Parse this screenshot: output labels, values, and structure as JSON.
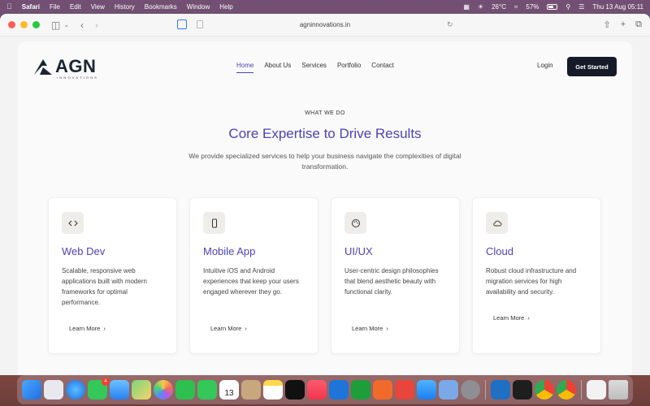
{
  "menubar": {
    "app": "Safari",
    "items": [
      "File",
      "Edit",
      "View",
      "History",
      "Bookmarks",
      "Window",
      "Help"
    ],
    "weather": "26°C",
    "battery": "57%",
    "datetime": "Thu 13 Aug  05:11"
  },
  "browser": {
    "url": "agninnovations.in"
  },
  "site": {
    "logo_text": "AGN",
    "logo_sub": "INNOVATIONS",
    "nav": [
      "Home",
      "About Us",
      "Services",
      "Portfolio",
      "Contact"
    ],
    "active_nav": "Home",
    "login": "Login",
    "cta": "Get Started"
  },
  "section": {
    "kicker": "WHAT WE DO",
    "title": "Core Expertise to Drive Results",
    "lead": "We provide specialized services to help your business navigate the complexities of digital transformation."
  },
  "cards": [
    {
      "icon": "code-icon",
      "title": "Web Dev",
      "desc": "Scalable, responsive web applications built with modern frameworks for optimal performance.",
      "link": "Learn More"
    },
    {
      "icon": "mobile-icon",
      "title": "Mobile App",
      "desc": "Intuitive iOS and Android experiences that keep your users engaged wherever they go.",
      "link": "Learn More"
    },
    {
      "icon": "palette-icon",
      "title": "UI/UX",
      "desc": "User-centric design philosophies that blend aesthetic beauty with functional clarity.",
      "link": "Learn More"
    },
    {
      "icon": "cloud-icon",
      "title": "Cloud",
      "desc": "Robust cloud infrastructure and migration services for high availability and security.",
      "link": "Learn More"
    }
  ],
  "dock": {
    "messages_badge": "4",
    "calendar_day": "13",
    "apps": [
      "Finder",
      "Launchpad",
      "Safari",
      "Messages",
      "Mail",
      "Maps",
      "Photos",
      "FaceTime",
      "Phone",
      "Calendar",
      "Contacts",
      "Notes",
      "TV",
      "Music",
      "Keynote",
      "Numbers",
      "Pages",
      "Rocket",
      "App Store",
      "Preview",
      "System Settings",
      "VS Code",
      "Figma",
      "Chrome",
      "Chrome Canary",
      "Document",
      "Trash"
    ]
  }
}
